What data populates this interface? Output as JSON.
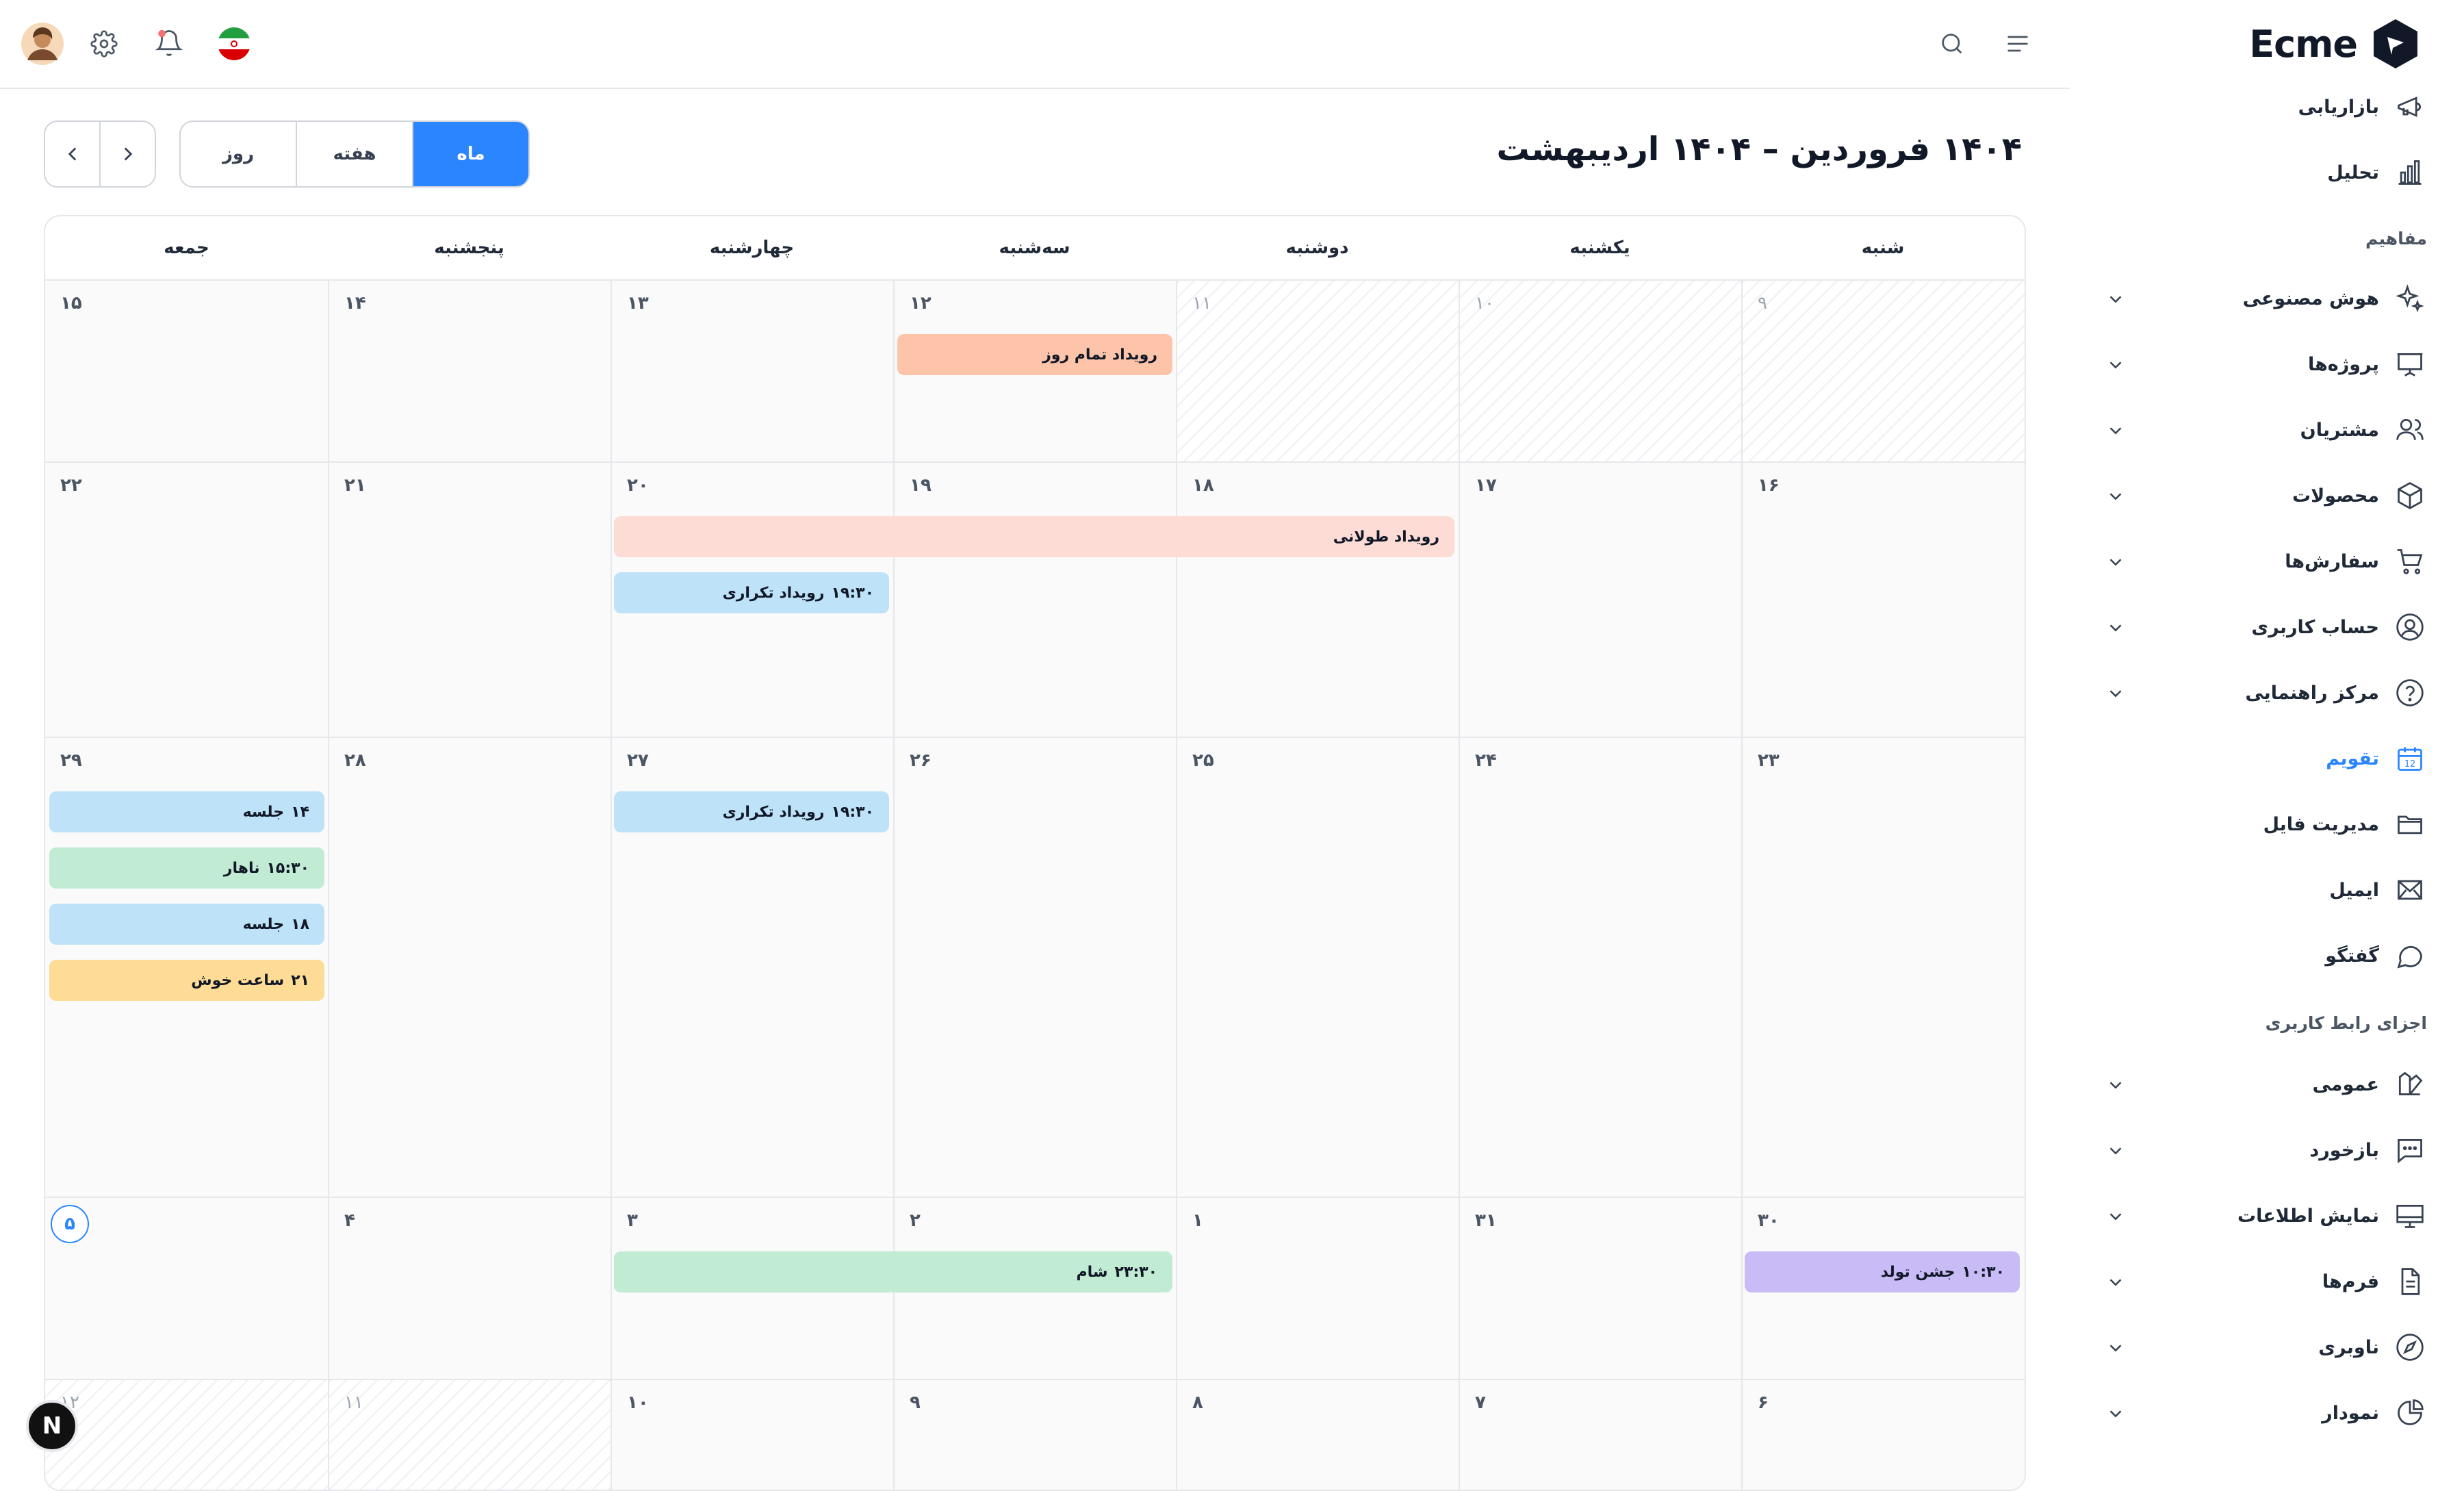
{
  "brand": {
    "name": "Ecme"
  },
  "colors": {
    "accent": "#2a85ff",
    "event_pink": "#fddcd6",
    "event_salmon": "#fdc4a9",
    "event_blue": "#bee3f8",
    "event_green": "#c2ebd3",
    "event_yellow": "#fedc95",
    "event_purple": "#c9bbf5"
  },
  "sidebar": {
    "top_items": [
      {
        "label": "بازاریابی",
        "icon": "megaphone-icon"
      },
      {
        "label": "تحلیل",
        "icon": "bar-chart-icon"
      }
    ],
    "section1": "مفاهیم",
    "concept_items": [
      {
        "label": "هوش مصنوعی",
        "icon": "sparkles-icon"
      },
      {
        "label": "پروژه‌ها",
        "icon": "presentation-icon"
      },
      {
        "label": "مشتریان",
        "icon": "users-icon"
      },
      {
        "label": "محصولات",
        "icon": "box-icon"
      },
      {
        "label": "سفارش‌ها",
        "icon": "cart-icon"
      },
      {
        "label": "حساب کاربری",
        "icon": "user-circle-icon"
      },
      {
        "label": "مرکز راهنمایی",
        "icon": "help-circle-icon"
      },
      {
        "label": "تقویم",
        "icon": "calendar-icon"
      },
      {
        "label": "مدیریت فایل",
        "icon": "folder-icon"
      },
      {
        "label": "ایمیل",
        "icon": "mail-icon"
      },
      {
        "label": "گفتگو",
        "icon": "chat-icon"
      }
    ],
    "section2": "اجزای رابط کاربری",
    "ui_items": [
      {
        "label": "عمومی",
        "icon": "swatch-icon"
      },
      {
        "label": "بازخورد",
        "icon": "message-dots-icon"
      },
      {
        "label": "نمایش اطلاعات",
        "icon": "monitor-icon"
      },
      {
        "label": "فرم‌ها",
        "icon": "document-icon"
      },
      {
        "label": "ناوبری",
        "icon": "compass-icon"
      },
      {
        "label": "نمودار",
        "icon": "pie-chart-icon"
      }
    ]
  },
  "toolbar": {
    "title": "۱۴۰۴ فروردین – ۱۴۰۴ اردیبهشت",
    "views": {
      "month": "ماه",
      "week": "هفته",
      "day": "روز"
    }
  },
  "calendar": {
    "weekdays": [
      "شنبه",
      "یکشنبه",
      "دوشنبه",
      "سه‌شنبه",
      "چهارشنبه",
      "پنجشنبه",
      "جمعه"
    ],
    "weeks": [
      [
        "۹",
        "۱۰",
        "۱۱",
        "۱۲",
        "۱۳",
        "۱۴",
        "۱۵"
      ],
      [
        "۱۶",
        "۱۷",
        "۱۸",
        "۱۹",
        "۲۰",
        "۲۱",
        "۲۲"
      ],
      [
        "۲۳",
        "۲۴",
        "۲۵",
        "۲۶",
        "۲۷",
        "۲۸",
        "۲۹"
      ],
      [
        "۳۰",
        "۳۱",
        "۱",
        "۲",
        "۳",
        "۴",
        "۵"
      ],
      [
        "۶",
        "۷",
        "۸",
        "۹",
        "۱۰",
        "۱۱",
        "۱۲"
      ]
    ],
    "today": "۵",
    "events": {
      "all_day": "رویداد تمام روز",
      "long": "رویداد طولانی",
      "repeat1_time": "۱۹:۳۰",
      "repeat1_title": "رویداد تکراری",
      "repeat2_time": "۱۹:۳۰",
      "repeat2_title": "رویداد تکراری",
      "meeting1_time": "۱۴",
      "meeting1_title": "جلسه",
      "lunch_time": "۱۵:۳۰",
      "lunch_title": "ناهار",
      "meeting2_time": "۱۸",
      "meeting2_title": "جلسه",
      "happy_time": "۲۱",
      "happy_title": "ساعت خوش",
      "dinner_time": "۲۳:۳۰",
      "dinner_title": "شام",
      "birthday_time": "۱۰:۳۰",
      "birthday_title": "جشن تولد"
    }
  },
  "badge": "N"
}
